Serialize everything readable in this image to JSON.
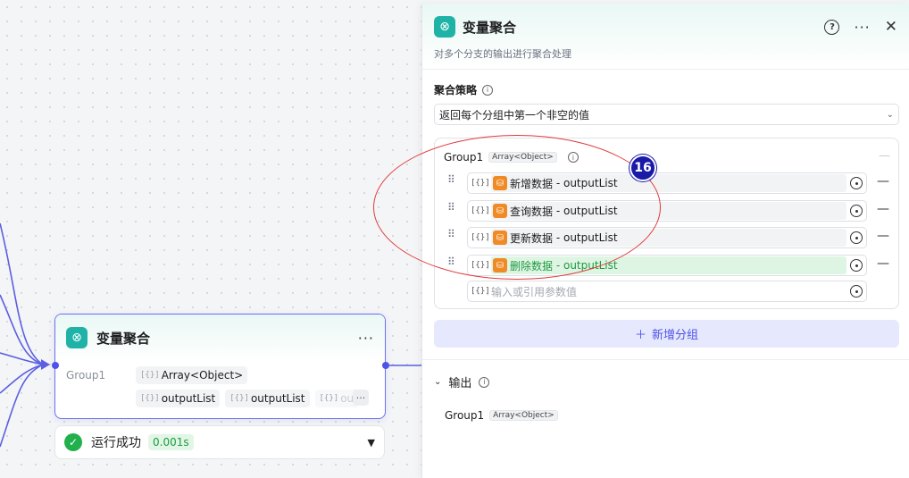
{
  "node": {
    "title": "变量聚合",
    "more": "···",
    "group_label": "Group1",
    "group_type": "Array<Object>",
    "outputs": [
      "outputList",
      "outputList",
      "ou"
    ],
    "more_chip": "···"
  },
  "status": {
    "text": "运行成功",
    "duration": "0.001s"
  },
  "panel": {
    "title": "变量聚合",
    "description": "对多个分支的输出进行聚合处理",
    "strategy_label": "聚合策略",
    "strategy_value": "返回每个分组中第一个非空的值",
    "group": {
      "name": "Group1",
      "type": "Array<Object>",
      "vars": [
        {
          "source": "新增数据",
          "field": "outputList",
          "highlighted": false
        },
        {
          "source": "查询数据",
          "field": "outputList",
          "highlighted": false
        },
        {
          "source": "更新数据",
          "field": "outputList",
          "highlighted": false
        },
        {
          "source": "删除数据",
          "field": "outputList",
          "highlighted": true
        }
      ],
      "input_placeholder": "输入或引用参数值"
    },
    "add_group_label": "新增分组",
    "output_label": "输出",
    "output_group": {
      "name": "Group1",
      "type": "Array<Object>"
    }
  },
  "annotation": {
    "badge": "16"
  },
  "colors": {
    "accent": "#4d53e8",
    "node_icon": "#1fb3a7",
    "db_icon": "#f08a24",
    "success": "#22b04c",
    "annotation": "#e23a3a"
  }
}
